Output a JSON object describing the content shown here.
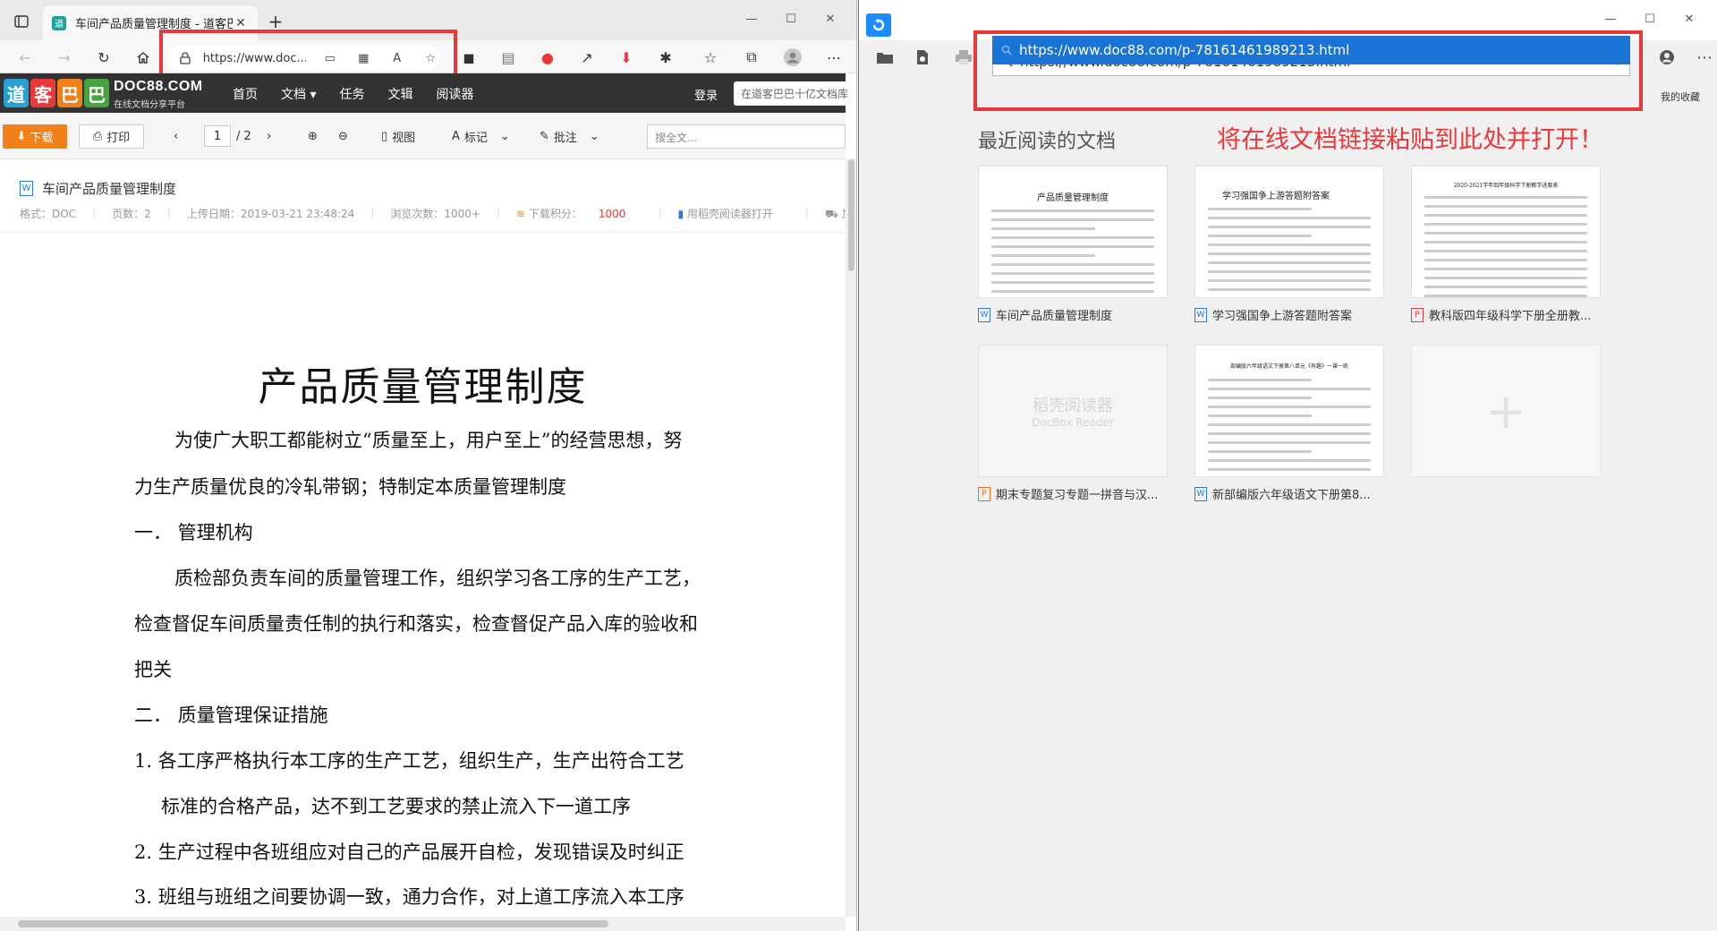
{
  "left_browser": {
    "tab_title": "车间产品质量管理制度 - 道客巴巴",
    "address_url": "https://www.doc...",
    "site": {
      "logo_cn": [
        "道",
        "客",
        "巴",
        "巴"
      ],
      "logo_colors": [
        "#2a9fd6",
        "#e8383a",
        "#f18019",
        "#47a33d"
      ],
      "logo_en": "DOC88.COM",
      "logo_sub": "在线文档分享平台",
      "nav": [
        "首页",
        "文档",
        "任务",
        "文辑",
        "阅读器"
      ],
      "login": "登录",
      "search_placeholder": "在道客巴巴十亿文档库"
    },
    "doc_toolbar": {
      "download": "下载",
      "print": "打印",
      "page_current": "1",
      "page_total": "/ 2",
      "view": "视图",
      "mark": "标记",
      "annotate": "批注",
      "search_placeholder": "搜全文..."
    },
    "doc_info": {
      "title": "车间产品质量管理制度",
      "format": "格式：DOC",
      "pages": "页数：2",
      "upload_date": "上传日期：2019-03-21 23:48:24",
      "views": "浏览次数：1000+",
      "points_label": "下载积分：",
      "points_value": "1000",
      "open_reader": "用稻壳阅读器打开",
      "add_list": "加入下载清单"
    },
    "document": {
      "heading": "产品质量管理制度",
      "lines": [
        "为使广大职工都能树立“质量至上，用户至上”的经营思想，努",
        "力生产质量优良的冷轧带钢；特制定本质量管理制度",
        "一．  管理机构",
        "质检部负责车间的质量管理工作，组织学习各工序的生产工艺，",
        "检查督促车间质量责任制的执行和落实，检查督促产品入库的验收和",
        "把关",
        "二．  质量管理保证措施",
        "1.  各工序严格执行本工序的生产工艺，组织生产，生产出符合工艺",
        "标准的合格产品，达不到工艺要求的禁止流入下一道工序",
        "2.  生产过程中各班组应对自己的产品展开自检，发现错误及时纠正",
        "3.  班组与班组之间要协调一致，通力合作，对上道工序流入本工序"
      ]
    }
  },
  "right_reader": {
    "url_input": "https://www.doc88.com/p-78161461989213.html",
    "url_suggestion": "https://www.doc88.com/p-78161461989213.html",
    "favorites_link": "我的收藏",
    "recent_title": "最近阅读的文档",
    "hint": "将在线文档链接粘贴到此处并打开！",
    "docbox_name": "稻壳阅读器",
    "docbox_en": "DocBox Reader",
    "recent_docs": [
      {
        "label": "车间产品质量管理制度",
        "type": "W",
        "thumb_title": "产品质量管理制度"
      },
      {
        "label": "学习强国争上游答题附答案",
        "type": "W",
        "thumb_title": "学习强国争上游答题附答案"
      },
      {
        "label": "教科版四年级科学下册全册教...",
        "type": "P",
        "thumb_title": "2020-2021学年四年级科学下册教学进度表"
      },
      {
        "label": "期末专题复习专题一拼音与汉...",
        "type": "O",
        "thumb_title": ""
      },
      {
        "label": "新部编版六年级语文下册第8...",
        "type": "W",
        "thumb_title": "部编版六年级语文下册第八单元《有趣》一课一练"
      }
    ]
  },
  "colors": {
    "highlight_box": "#e8383a",
    "download_btn": "#f18019",
    "suggestion_bg": "#1a74d6"
  }
}
